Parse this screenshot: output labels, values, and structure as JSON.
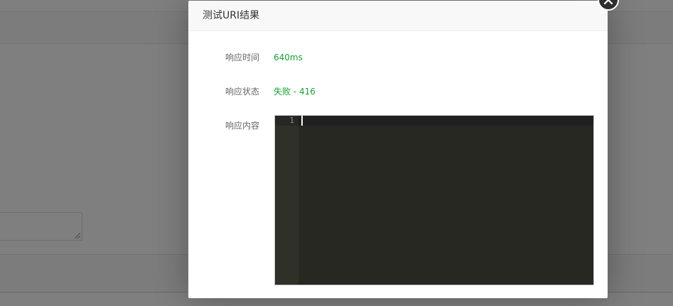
{
  "modal": {
    "title": "测试URI结果"
  },
  "fields": {
    "response_time": {
      "label": "响应时间",
      "value": "640ms"
    },
    "response_status": {
      "label": "响应状态",
      "value": "失败 - 416"
    },
    "response_body": {
      "label": "响应内容"
    }
  },
  "editor": {
    "line_numbers": [
      "1"
    ],
    "content": ""
  },
  "colors": {
    "value_green": "#1aa034",
    "editor_bg": "#272822",
    "overlay": "rgba(0,0,0,0.5)"
  },
  "icons": {
    "close": "close-icon"
  }
}
